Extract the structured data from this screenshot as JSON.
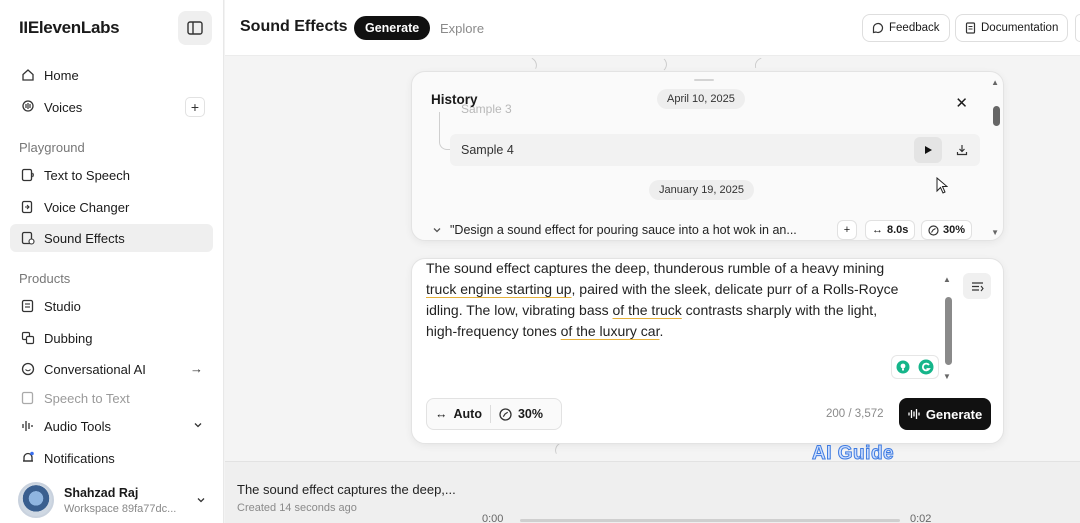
{
  "sidebar": {
    "logo": "IIElevenLabs",
    "items_top": [
      {
        "label": "Home",
        "icon": "home-icon"
      },
      {
        "label": "Voices",
        "icon": "voices-icon",
        "trail": "+"
      }
    ],
    "section_playground": "Playground",
    "playground_items": [
      {
        "label": "Text to Speech",
        "icon": "text-to-speech-icon"
      },
      {
        "label": "Voice Changer",
        "icon": "voice-changer-icon"
      },
      {
        "label": "Sound Effects",
        "icon": "sound-effects-icon"
      }
    ],
    "section_products": "Products",
    "product_items": [
      {
        "label": "Studio",
        "icon": "studio-icon"
      },
      {
        "label": "Dubbing",
        "icon": "dubbing-icon"
      },
      {
        "label": "Conversational AI",
        "icon": "conversational-ai-icon",
        "trail": "→"
      },
      {
        "label": "Speech to Text",
        "icon": "speech-to-text-icon"
      },
      {
        "label": "Audio Tools",
        "icon": "audio-tools-icon"
      },
      {
        "label": "Notifications",
        "icon": "bell-icon"
      }
    ],
    "user": {
      "name": "Shahzad Raj",
      "workspace": "Workspace 89fa77dc..."
    }
  },
  "topbar": {
    "title": "Sound Effects",
    "tab_generate": "Generate",
    "tab_explore": "Explore",
    "feedback": "Feedback",
    "documentation": "Documentation"
  },
  "history": {
    "title": "History",
    "ghost_sample": "Sample 3",
    "date_1": "April 10, 2025",
    "sample_label": "Sample 4",
    "date_2": "January 19, 2025",
    "prompt_preview": "\"Design a sound effect for pouring sauce into a hot wok in an...",
    "plus": "+",
    "duration": "8.0s",
    "influence": "30%"
  },
  "prompt": {
    "line1": "The sound effect captures the deep, thunderous rumble of a heavy mining",
    "line2a": "truck engine starting up",
    "line2b": ", paired with the sleek, delicate purr of a Rolls-Royce",
    "line3a": "idling. The low, vibrating bass ",
    "line3b": "of the truck",
    "line3c": " contrasts sharply with the light,",
    "line4a": "high-frequency tones ",
    "line4b": "of the luxury car",
    "line4c": ".",
    "duration_mode": "Auto",
    "influence": "30%",
    "char_count": "200 / 3,572",
    "generate_label": "Generate"
  },
  "player": {
    "title": "The sound effect captures the deep,...",
    "subtitle": "Created 14 seconds ago",
    "time_start": "0:00",
    "time_end": "0:02"
  },
  "watermark": "AI Guide",
  "colors": {
    "accent_dark": "#111111",
    "underline": "#e6b13a",
    "watermark_stroke": "#3f7be0"
  }
}
